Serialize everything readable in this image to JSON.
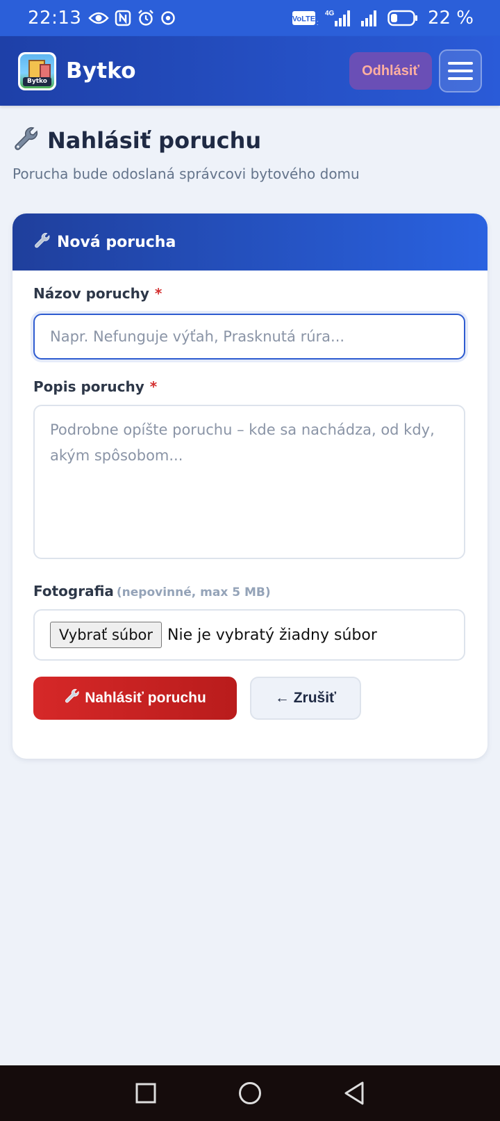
{
  "status_bar": {
    "time": "22:13",
    "network_label": "VoLTE",
    "network_type": "4G",
    "battery_percent": "22 %",
    "icons": [
      "eye-icon",
      "nfc-icon",
      "alarm-icon",
      "browser-icon",
      "volte-icon",
      "signal-4g-icon",
      "signal-icon",
      "battery-icon"
    ]
  },
  "appbar": {
    "brand": "Bytko",
    "logo_text": "Bytko",
    "logout_label": "Odhlásiť",
    "menu_icon": "hamburger-menu-icon"
  },
  "page": {
    "title_icon": "wrench-icon",
    "title": "Nahlásiť poruchu",
    "subtitle": "Porucha bude odoslaná správcovi bytového domu"
  },
  "form": {
    "header_title": "Nová porucha",
    "name_label": "Názov poruchy",
    "name_required": "*",
    "name_placeholder": "Napr. Nefunguje výťah, Prasknutá rúra...",
    "name_value": "",
    "desc_label": "Popis poruchy",
    "desc_required": "*",
    "desc_placeholder": "Podrobne opíšte poruchu – kde sa nachádza, od kdy, akým spôsobom...",
    "desc_value": "",
    "photo_label": "Fotografia",
    "photo_hint": "(nepovinné, max 5 MB)",
    "file_button": "Vybrať súbor",
    "file_status": "Nie je vybratý žiadny súbor",
    "submit_label": "Nahlásiť poruchu",
    "cancel_label": "← Zrušiť"
  },
  "colors": {
    "primary": "#2a5bd8",
    "danger": "#c62828",
    "page_bg": "#eef2f9"
  }
}
